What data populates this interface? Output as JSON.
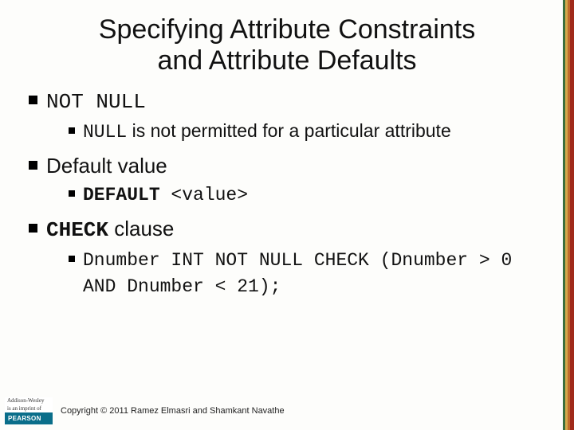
{
  "title_line1": "Specifying Attribute Constraints",
  "title_line2": "and Attribute Defaults",
  "bullets": {
    "b1": {
      "label": "NOT NULL",
      "sub_code": "NULL",
      "sub_text": " is not permitted for a particular attribute"
    },
    "b2": {
      "label": "Default value",
      "sub_bold": "DEFAULT ",
      "sub_code": "<value>"
    },
    "b3": {
      "label_bold": "CHECK",
      "label_rest": " clause",
      "sub_code": "Dnumber INT NOT NULL CHECK (Dnumber > 0 AND Dnumber < 21);"
    }
  },
  "footer": {
    "logo_top1": "Addison-Wesley",
    "logo_top2": "is an imprint of",
    "logo_brand": "PEARSON",
    "copyright": "Copyright © 2011 Ramez Elmasri and Shamkant Navathe"
  }
}
